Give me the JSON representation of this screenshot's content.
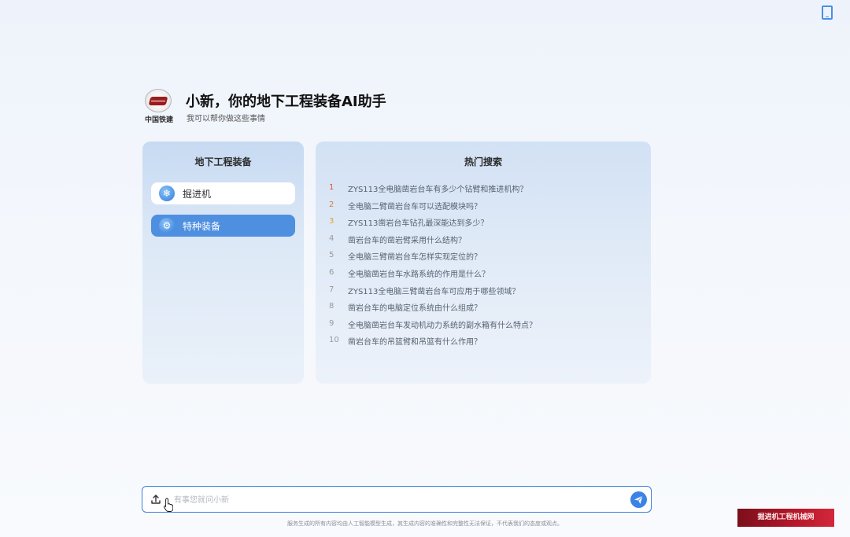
{
  "header": {
    "logo_text": "中国铁建",
    "title": "小新，你的地下工程装备AI助手",
    "subtitle": "我可以帮你做这些事情"
  },
  "categories": {
    "title": "地下工程装备",
    "items": [
      {
        "label": "掘进机",
        "icon": "snowflake-icon",
        "selected": false
      },
      {
        "label": "特种装备",
        "icon": "gear-icon",
        "selected": true
      }
    ]
  },
  "hot_search": {
    "title": "热门搜索",
    "items": [
      {
        "rank": "1",
        "text": "ZYS113全电脑凿岩台车有多少个钻臂和推进机构？"
      },
      {
        "rank": "2",
        "text": "全电脑二臂凿岩台车可以选配模块吗？"
      },
      {
        "rank": "3",
        "text": "ZYS113凿岩台车钻孔最深能达到多少？"
      },
      {
        "rank": "4",
        "text": "凿岩台车的凿岩臂采用什么结构？"
      },
      {
        "rank": "5",
        "text": "全电脑三臂凿岩台车怎样实现定位的？"
      },
      {
        "rank": "6",
        "text": "全电脑凿岩台车水路系统的作用是什么？"
      },
      {
        "rank": "7",
        "text": "ZYS113全电脑三臂凿岩台车可应用于哪些领域？"
      },
      {
        "rank": "8",
        "text": "凿岩台车的电脑定位系统由什么组成？"
      },
      {
        "rank": "9",
        "text": "全电脑凿岩台车发动机动力系统的副水箱有什么特点？"
      },
      {
        "rank": "10",
        "text": "凿岩台车的吊篮臂和吊篮有什么作用？"
      }
    ]
  },
  "input": {
    "placeholder": "有事您就问小新"
  },
  "footer": {
    "disclaimer": "服务生成的所有内容均由人工智能模型生成，其生成内容的准确性和完整性无法保证，不代表我们的态度或观点。"
  },
  "watermark": {
    "text": "掘进机工程机械网"
  },
  "colors": {
    "accent": "#3b83e6",
    "selected_item": "#4f8fe0",
    "rank_1": "#e0533b"
  }
}
